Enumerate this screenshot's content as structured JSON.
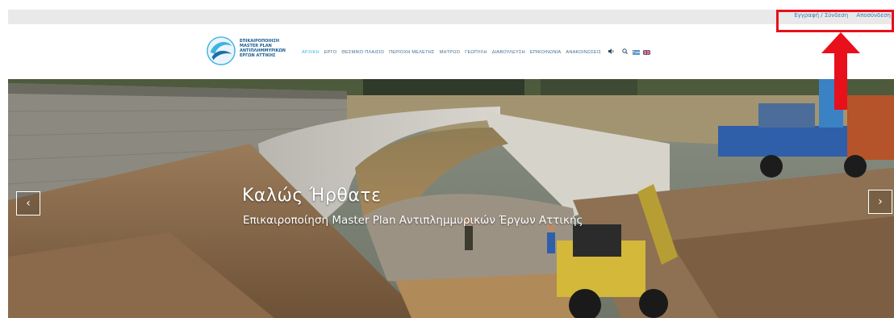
{
  "topbar": {
    "links": [
      "Εγγραφή / Σύνδεση",
      "Αποσύνδεση"
    ]
  },
  "logo": {
    "text_lines": [
      "ΕΠΙΚΑΙΡΟΠΟΙΗΣΗ",
      "MASTER PLAN",
      "ΑΝΤΙΠΛΗΜΜΥΡΙΚΩΝ",
      "ΕΡΓΩΝ ΑΤΤΙΚΗΣ"
    ]
  },
  "nav": {
    "items": [
      {
        "label": "ΑΡΧΙΚΗ",
        "active": true
      },
      {
        "label": "ΕΡΓΟ",
        "active": false
      },
      {
        "label": "ΘΕΣΜΙΚΟ ΠΛΑΙΣΙΟ",
        "active": false
      },
      {
        "label": "ΠΕΡΙΟΧΗ ΜΕΛΕΤΗΣ",
        "active": false
      },
      {
        "label": "ΜΗΤΡΩΟ",
        "active": false
      },
      {
        "label": "ΓΕΩΠΥΛΗ",
        "active": false
      },
      {
        "label": "ΔΙΑΒΟΥΛΕΥΣΗ",
        "active": false
      },
      {
        "label": "ΕΠΙΚΟΙΝΩΝΙΑ",
        "active": false
      },
      {
        "label": "ΑΝΑΚΟΙΝΩΣΕΙΣ",
        "active": false
      }
    ],
    "tools": {
      "speaker_icon": "speaker-icon",
      "search_icon": "search-icon"
    },
    "flags": [
      "greek-flag-icon",
      "uk-flag-icon"
    ]
  },
  "hero": {
    "title": "Καλώς Ήρθατε",
    "subtitle": "Επικαιροποίηση Master Plan Αντιπλημμυρικών Έργων Αττικής",
    "prev_label": "‹",
    "next_label": "›"
  },
  "colors": {
    "annotation_red": "#e8101a",
    "nav_text": "#3e6d94",
    "nav_active": "#3fb3e0"
  }
}
